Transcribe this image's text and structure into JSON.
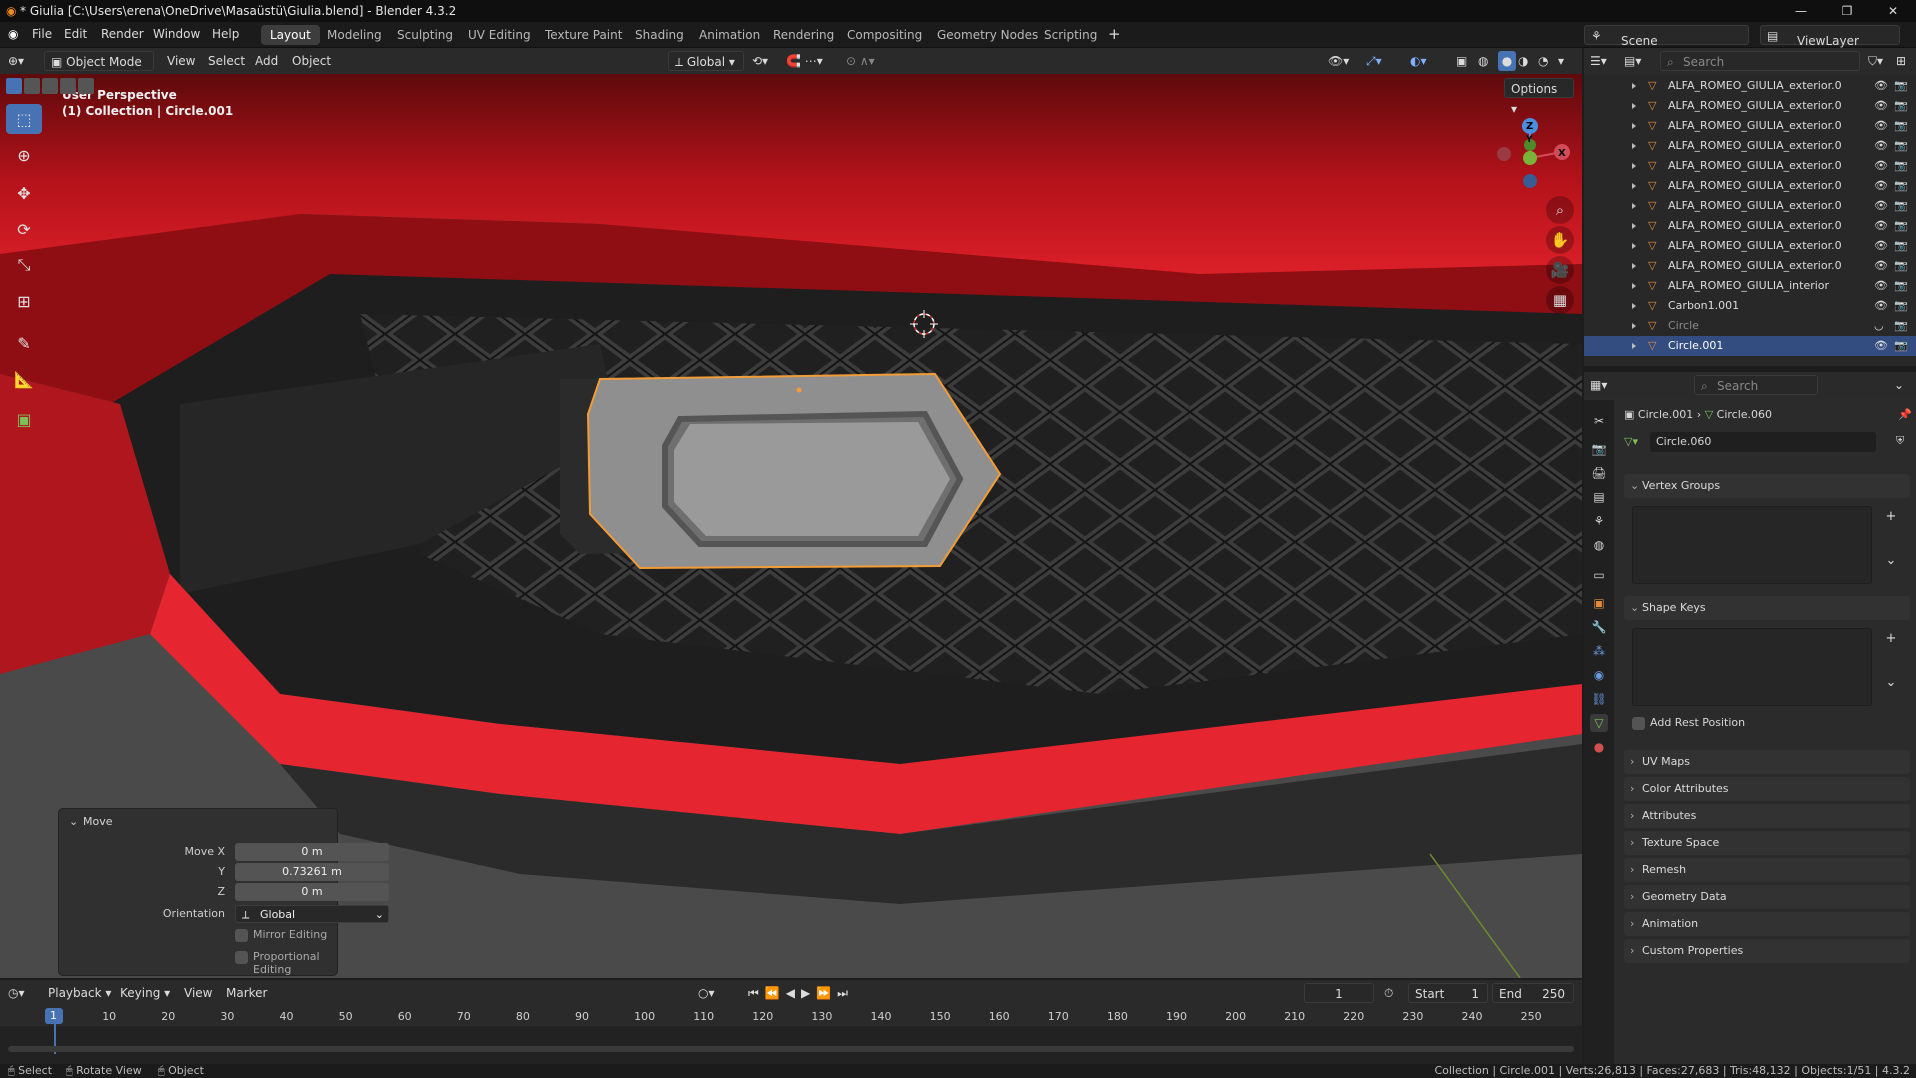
{
  "window": {
    "title": "* Giulia [C:\\Users\\erena\\OneDrive\\Masaüstü\\Giulia.blend] - Blender 4.3.2",
    "controls": [
      "—",
      "❐",
      "✕"
    ]
  },
  "menu": [
    "File",
    "Edit",
    "Render",
    "Window",
    "Help"
  ],
  "workspaces": [
    "Layout",
    "Modeling",
    "Sculpting",
    "UV Editing",
    "Texture Paint",
    "Shading",
    "Animation",
    "Rendering",
    "Compositing",
    "Geometry Nodes",
    "Scripting"
  ],
  "active_workspace": "Layout",
  "scene": {
    "label": "Scene",
    "view_layer": "ViewLayer"
  },
  "viewport_header": {
    "mode": "Object Mode",
    "menus": [
      "View",
      "Select",
      "Add",
      "Object"
    ],
    "orientation": "Global",
    "options": "Options"
  },
  "viewport": {
    "perspective": "User Perspective",
    "collection_path": "(1) Collection | Circle.001",
    "gizmo": {
      "x": "X",
      "y": "Y",
      "z": "Z"
    }
  },
  "move_panel": {
    "title": "Move",
    "move_x_label": "Move X",
    "move_x": "0 m",
    "y_label": "Y",
    "y": "0.73261 m",
    "z_label": "Z",
    "z": "0 m",
    "orientation_label": "Orientation",
    "orientation": "Global",
    "mirror": "Mirror Editing",
    "proportional": "Proportional Editing"
  },
  "outliner": {
    "search_placeholder": "Search",
    "items": [
      {
        "name": "ALFA_ROMEO_GIULIA_exterior.0",
        "selected": false,
        "dim": false
      },
      {
        "name": "ALFA_ROMEO_GIULIA_exterior.0",
        "selected": false,
        "dim": false
      },
      {
        "name": "ALFA_ROMEO_GIULIA_exterior.0",
        "selected": false,
        "dim": false
      },
      {
        "name": "ALFA_ROMEO_GIULIA_exterior.0",
        "selected": false,
        "dim": false
      },
      {
        "name": "ALFA_ROMEO_GIULIA_exterior.0",
        "selected": false,
        "dim": false
      },
      {
        "name": "ALFA_ROMEO_GIULIA_exterior.0",
        "selected": false,
        "dim": false
      },
      {
        "name": "ALFA_ROMEO_GIULIA_exterior.0",
        "selected": false,
        "dim": false
      },
      {
        "name": "ALFA_ROMEO_GIULIA_exterior.0",
        "selected": false,
        "dim": false
      },
      {
        "name": "ALFA_ROMEO_GIULIA_exterior.0",
        "selected": false,
        "dim": false
      },
      {
        "name": "ALFA_ROMEO_GIULIA_exterior.0",
        "selected": false,
        "dim": false
      },
      {
        "name": "ALFA_ROMEO_GIULIA_interior",
        "selected": false,
        "dim": false
      },
      {
        "name": "Carbon1.001",
        "selected": false,
        "dim": false
      },
      {
        "name": "Circle",
        "selected": false,
        "dim": true
      },
      {
        "name": "Circle.001",
        "selected": true,
        "dim": false
      }
    ]
  },
  "properties": {
    "search_placeholder": "Search",
    "breadcrumb_object": "Circle.001",
    "breadcrumb_mesh": "Circle.060",
    "mesh_name": "Circle.060",
    "sections": {
      "vertex_groups": "Vertex Groups",
      "shape_keys": "Shape Keys",
      "add_rest_position": "Add Rest Position",
      "collapsed": [
        "UV Maps",
        "Color Attributes",
        "Attributes",
        "Texture Space",
        "Remesh",
        "Geometry Data",
        "Animation",
        "Custom Properties"
      ]
    }
  },
  "timeline": {
    "menus": [
      "Playback",
      "Keying",
      "View",
      "Marker"
    ],
    "current_frame": "1",
    "start_label": "Start",
    "start": "1",
    "end_label": "End",
    "end": "250",
    "ticks": [
      "1",
      "10",
      "20",
      "30",
      "40",
      "50",
      "60",
      "70",
      "80",
      "90",
      "100",
      "110",
      "120",
      "130",
      "140",
      "150",
      "160",
      "170",
      "180",
      "190",
      "200",
      "210",
      "220",
      "230",
      "240",
      "250"
    ]
  },
  "statusbar": {
    "left": [
      "Select",
      "Rotate View",
      "Object"
    ],
    "right": "Collection | Circle.001 | Verts:26,813 | Faces:27,683 | Tris:48,132 | Objects:1/51 | 4.3.2"
  }
}
